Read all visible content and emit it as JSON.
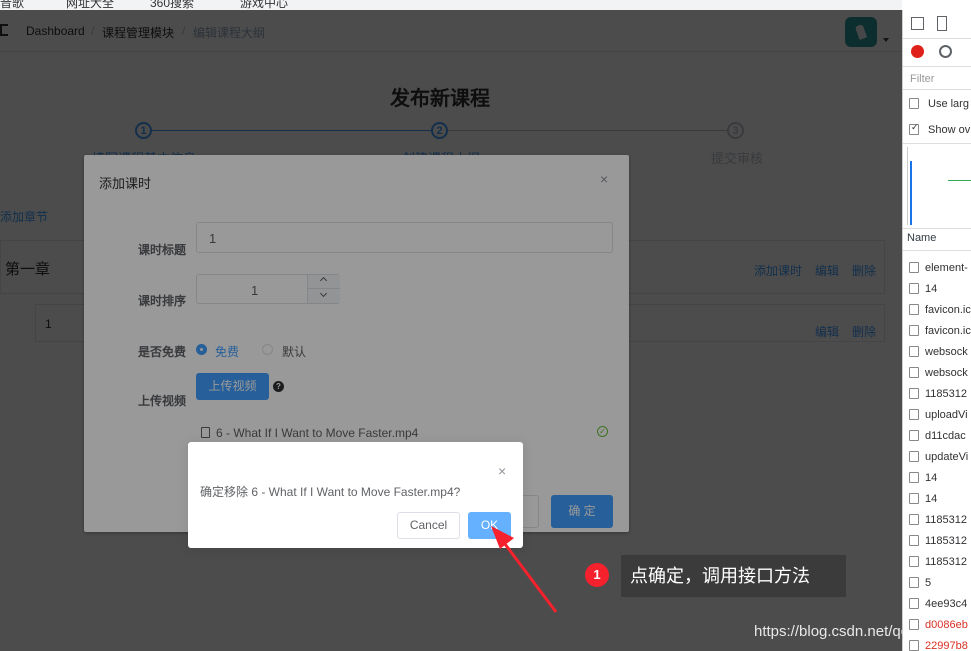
{
  "bookmarks": [
    "音歌",
    "网址大全",
    "360搜索",
    "游戏中心"
  ],
  "breadcrumb": {
    "home": "Dashboard",
    "module": "课程管理模块",
    "current": "编辑课程大纲",
    "separator": "/"
  },
  "page": {
    "title": "发布新课程"
  },
  "steps": [
    {
      "num": "1",
      "label": "填写课程基本信息"
    },
    {
      "num": "2",
      "label": "创建课程大纲"
    },
    {
      "num": "3",
      "label": "提交审核"
    }
  ],
  "chapter": {
    "add_chapter": "添加章节",
    "title": "第一章",
    "add_lesson": "添加课时",
    "edit": "编辑",
    "delete": "删除",
    "lesson_title": "1"
  },
  "dialog": {
    "title": "添加课时",
    "close_icon": "×",
    "lesson_title_label": "课时标题",
    "lesson_title_value": "1",
    "lesson_order_label": "课时排序",
    "lesson_order_value": "1",
    "free_label": "是否免费",
    "free_option": "免费",
    "default_option": "默认",
    "upload_label": "上传视频",
    "upload_button": "上传视频",
    "help_icon": "?",
    "file_name": "6 - What If I Want to Move Faster.mp4",
    "confirm_button": "确 定"
  },
  "msgbox": {
    "close_icon": "×",
    "message": "确定移除 6 - What If I Want to Move Faster.mp4?",
    "cancel": "Cancel",
    "ok": "OK"
  },
  "annotation": {
    "badge": "1",
    "text": "点确定，调用接口方法"
  },
  "watermark": "https://blog.csdn.net/qq_javP",
  "devtools": {
    "filter_placeholder": "Filter",
    "use_large": "Use larg",
    "show_overview": "Show ov",
    "name_header": "Name",
    "requests": [
      "element-",
      "14",
      "favicon.ic",
      "favicon.ic",
      "websock",
      "websock",
      "1185312",
      "uploadVi",
      "d11cdac",
      "updateVi",
      "14",
      "14",
      "1185312",
      "1185312",
      "1185312",
      "5",
      "4ee93c4",
      "d0086eb",
      "22997b8"
    ]
  },
  "colors": {
    "primary": "#409eff",
    "success": "#67c23a",
    "danger": "#f5222d",
    "ok_button": "#66b1ff"
  }
}
